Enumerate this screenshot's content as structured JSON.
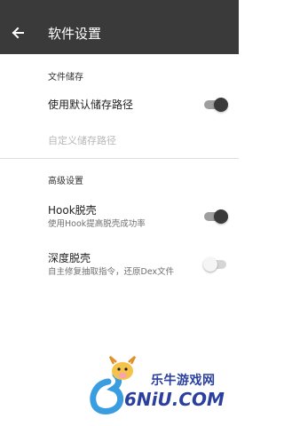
{
  "toolbar": {
    "back_icon": "arrow-left-icon",
    "title": "软件设置",
    "background": "#3a3a3a"
  },
  "sections": {
    "storage": {
      "header": "文件储存",
      "default_path": {
        "title": "使用默认储存路径",
        "switch_on": true
      },
      "custom_path": {
        "title": "自定义储存路径",
        "enabled": false
      }
    },
    "advanced": {
      "header": "高级设置",
      "hook_unpack": {
        "title": "Hook脱壳",
        "summary": "使用Hook提高脱壳成功率",
        "switch_on": true
      },
      "deep_unpack": {
        "title": "深度脱壳",
        "summary": "自主修复抽取指令，还原Dex文件",
        "switch_on": false
      }
    }
  },
  "watermark": {
    "name": "乐牛游戏网",
    "domain": "6NiU.COM"
  }
}
